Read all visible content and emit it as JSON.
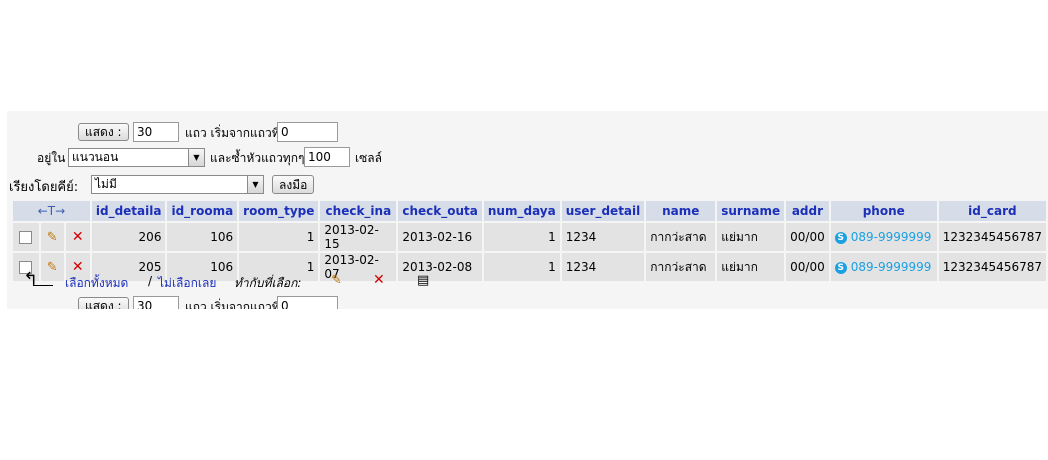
{
  "top_controls": {
    "show_button": "แสดง :",
    "rows_value": "30",
    "rows_label": "แถว เริ่มจากแถวที่",
    "start_value": "0",
    "mode_prefix": "อยู่ใน",
    "mode_value": "แนวนอน",
    "repeat_label": "และซ้ำหัวแถวทุกๆ",
    "repeat_value": "100",
    "cells_label": "เซลล์"
  },
  "sort": {
    "label": "เรียงโดยคีย์:",
    "value": "ไม่มี",
    "go_button": "ลงมือ"
  },
  "table": {
    "arrows_header": "←T→",
    "columns": [
      "id_detaila",
      "id_rooma",
      "room_type",
      "check_ina",
      "check_outa",
      "num_daya",
      "user_detail",
      "name",
      "surname",
      "addr",
      "phone",
      "id_card"
    ],
    "rows": [
      [
        "206",
        "106",
        "1",
        "2013-02-15",
        "2013-02-16",
        "1",
        "1234",
        "กากว่ะสาด",
        "แย่มาก",
        "00/00",
        "089-9999999",
        "1232345456787"
      ],
      [
        "205",
        "106",
        "1",
        "2013-02-07",
        "2013-02-08",
        "1",
        "1234",
        "กากว่ะสาด",
        "แย่มาก",
        "00/00",
        "089-9999999",
        "1232345456787"
      ]
    ]
  },
  "bottom": {
    "select_all": "เลือกทั้งหมด",
    "separator": "/",
    "select_none": "ไม่เลือกเลย",
    "with_selected": "ทำกับที่เลือก:",
    "show_button": "แสดง :",
    "rows_value": "30",
    "rows_label": "แถว เริ่มจากแถวที่",
    "start_value": "0"
  },
  "icons": {
    "edit": "pencil-icon",
    "delete": "x-icon",
    "export": "document-icon",
    "phone": "skype-icon"
  },
  "colors": {
    "header_bg": "#d6dde8",
    "header_text": "#1b2fb8",
    "row_bg": "#e3e3e3",
    "panel_bg": "#f5f5f5",
    "phone_link": "#1ba0e2",
    "delete": "#d10000"
  }
}
